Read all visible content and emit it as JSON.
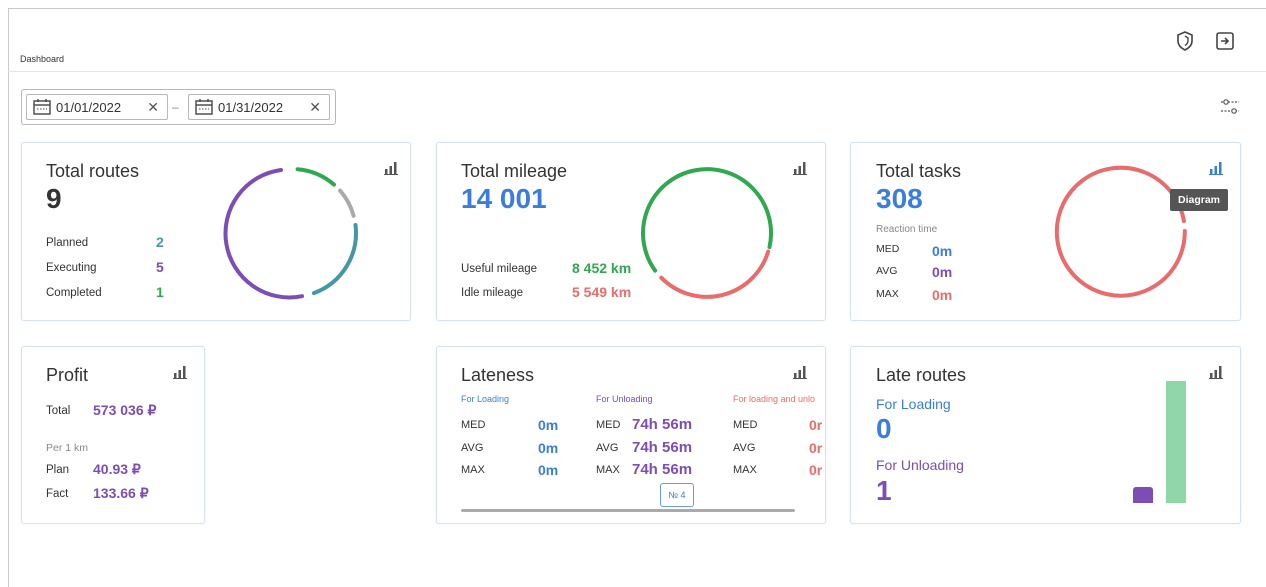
{
  "breadcrumb": "Dashboard",
  "header_icons": [
    "shield-icon",
    "logout-icon"
  ],
  "filters": {
    "date_from": "01/01/2022",
    "date_to": "01/31/2022",
    "separator": "–",
    "clear_symbol": "✕"
  },
  "colors": {
    "purple": "#7b4db5",
    "green": "#2fa84f",
    "blue": "#3b7ddd",
    "red": "#ea6b6b",
    "teal": "#4697a6",
    "gray": "#aaaaaa",
    "light_green": "#8fd7a9"
  },
  "total_routes": {
    "title": "Total routes",
    "value": "9",
    "rows": [
      {
        "label": "Planned",
        "value": "2"
      },
      {
        "label": "Executing",
        "value": "5"
      },
      {
        "label": "Completed",
        "value": "1"
      }
    ]
  },
  "total_mileage": {
    "title": "Total mileage",
    "value": "14 001",
    "rows": [
      {
        "label": "Useful mileage",
        "value": "8 452 km"
      },
      {
        "label": "Idle mileage",
        "value": "5 549 km"
      }
    ]
  },
  "total_tasks": {
    "title": "Total tasks",
    "value": "308",
    "reaction_label": "Reaction time",
    "rows": [
      {
        "label": "MED",
        "value": "0m"
      },
      {
        "label": "AVG",
        "value": "0m"
      },
      {
        "label": "MAX",
        "value": "0m"
      }
    ],
    "tooltip": "Diagram"
  },
  "profit": {
    "title": "Profit",
    "total_label": "Total",
    "total_value": "573 036 ₽",
    "per_km_label": "Per 1 km",
    "plan_label": "Plan",
    "plan_value": "40.93 ₽",
    "fact_label": "Fact",
    "fact_value": "133.66 ₽"
  },
  "lateness": {
    "title": "Lateness",
    "columns": [
      {
        "heading": "For Loading",
        "rows": [
          {
            "label": "MED",
            "value": "0m"
          },
          {
            "label": "AVG",
            "value": "0m"
          },
          {
            "label": "MAX",
            "value": "0m"
          }
        ]
      },
      {
        "heading": "For Unloading",
        "rows": [
          {
            "label": "MED",
            "value": "74h 56m"
          },
          {
            "label": "AVG",
            "value": "74h 56m"
          },
          {
            "label": "MAX",
            "value": "74h 56m"
          }
        ]
      },
      {
        "heading": "For loading and unlo",
        "rows": [
          {
            "label": "MED",
            "value": "0r"
          },
          {
            "label": "AVG",
            "value": "0r"
          },
          {
            "label": "MAX",
            "value": "0r"
          }
        ]
      }
    ],
    "pager": "№ 4"
  },
  "late_routes": {
    "title": "Late routes",
    "loading_label": "For Loading",
    "loading_value": "0",
    "unloading_label": "For Unloading",
    "unloading_value": "1"
  }
}
